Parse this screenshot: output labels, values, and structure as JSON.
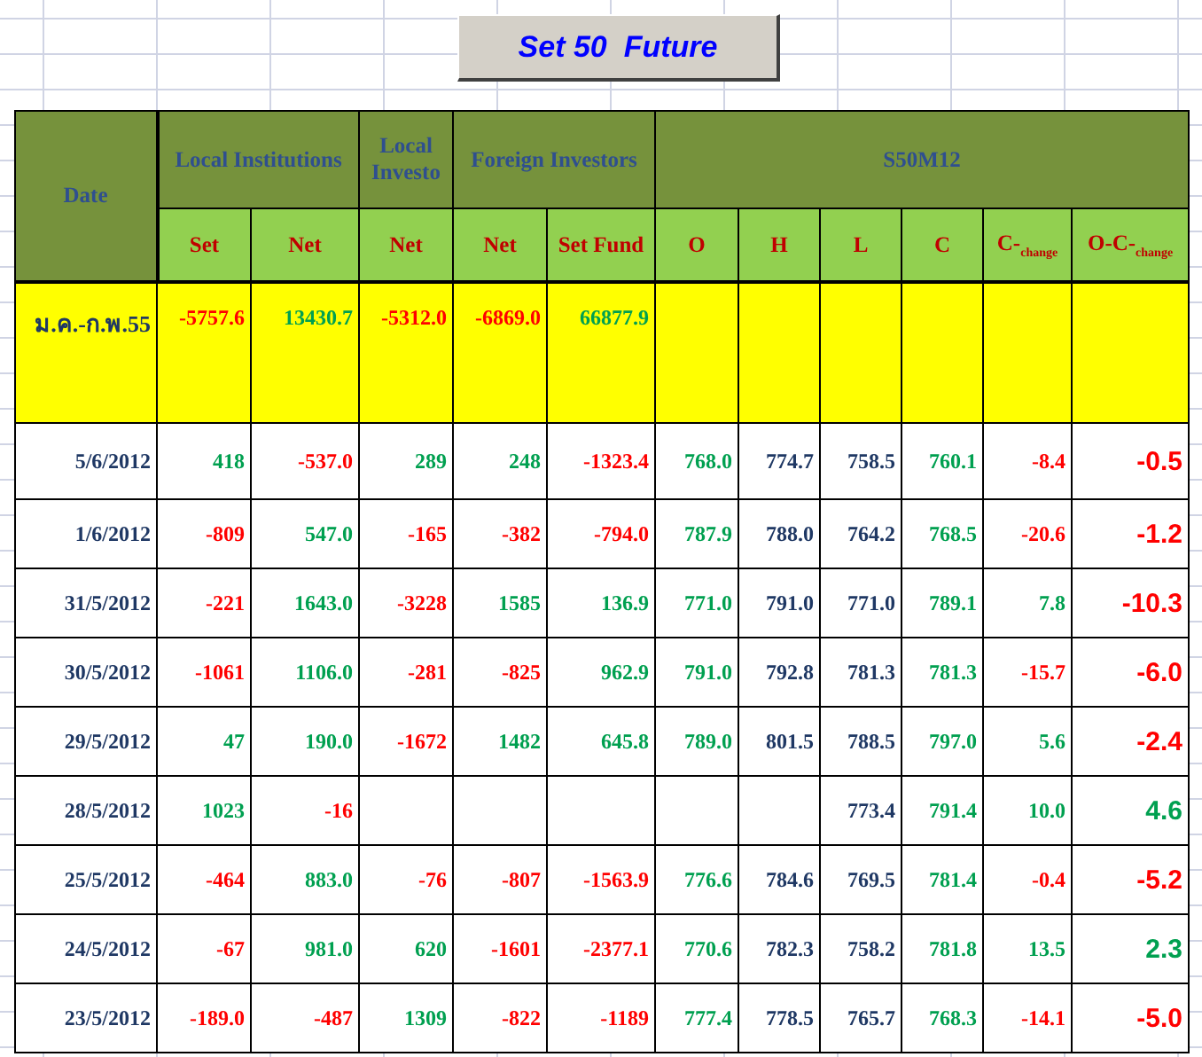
{
  "title": "Set 50  Future",
  "header": {
    "date": "Date",
    "groups": [
      {
        "label": "Local Institutions",
        "columns": [
          "Set",
          "Net"
        ]
      },
      {
        "label": "Local Investo",
        "columns": [
          "Net"
        ]
      },
      {
        "label": "Foreign Investors",
        "columns": [
          "Net",
          "Set Fund"
        ]
      },
      {
        "label": "S50M12",
        "columns": [
          "O",
          "H",
          "L",
          "C",
          "C-$_{change}$",
          "O-C-$_{change}$"
        ]
      }
    ]
  },
  "summary": {
    "date": "ม.ค.-ก.พ.55",
    "cells": [
      {
        "text": "-5757.6",
        "color": "#ff0000"
      },
      {
        "text": "13430.7",
        "color": "#00a050"
      },
      {
        "text": "-5312.0",
        "color": "#ff0000"
      },
      {
        "text": "-6869.0",
        "color": "#ff0000"
      },
      {
        "text": "66877.9",
        "color": "#00a050"
      },
      null,
      null,
      null,
      null,
      null,
      null
    ]
  },
  "rows": [
    {
      "date": "5/6/2012",
      "cells": [
        {
          "text": "418",
          "color": "#00a050"
        },
        {
          "text": "-537.0",
          "color": "#ff0000"
        },
        {
          "text": "289",
          "color": "#00a050"
        },
        {
          "text": "248",
          "color": "#00a050"
        },
        {
          "text": "-1323.4",
          "color": "#ff0000"
        },
        {
          "text": "768.0",
          "color": "#00a050"
        },
        {
          "text": "774.7",
          "color": "#1f3864"
        },
        {
          "text": "758.5",
          "color": "#1f3864"
        },
        {
          "text": "760.1",
          "color": "#00a050"
        },
        {
          "text": "-8.4",
          "color": "#ff0000"
        },
        {
          "text": "-0.5",
          "color": "#ff0000"
        }
      ]
    },
    {
      "date": "1/6/2012",
      "cells": [
        {
          "text": "-809",
          "color": "#ff0000"
        },
        {
          "text": "547.0",
          "color": "#00a050"
        },
        {
          "text": "-165",
          "color": "#ff0000"
        },
        {
          "text": "-382",
          "color": "#ff0000"
        },
        {
          "text": "-794.0",
          "color": "#ff0000"
        },
        {
          "text": "787.9",
          "color": "#00a050"
        },
        {
          "text": "788.0",
          "color": "#1f3864"
        },
        {
          "text": "764.2",
          "color": "#1f3864"
        },
        {
          "text": "768.5",
          "color": "#00a050"
        },
        {
          "text": "-20.6",
          "color": "#ff0000"
        },
        {
          "text": "-1.2",
          "color": "#ff0000"
        }
      ]
    },
    {
      "date": "31/5/2012",
      "cells": [
        {
          "text": "-221",
          "color": "#ff0000"
        },
        {
          "text": "1643.0",
          "color": "#00a050"
        },
        {
          "text": "-3228",
          "color": "#ff0000"
        },
        {
          "text": "1585",
          "color": "#00a050"
        },
        {
          "text": "136.9",
          "color": "#00a050"
        },
        {
          "text": "771.0",
          "color": "#00a050"
        },
        {
          "text": "791.0",
          "color": "#1f3864"
        },
        {
          "text": "771.0",
          "color": "#1f3864"
        },
        {
          "text": "789.1",
          "color": "#00a050"
        },
        {
          "text": "7.8",
          "color": "#00a050"
        },
        {
          "text": "-10.3",
          "color": "#ff0000"
        }
      ]
    },
    {
      "date": "30/5/2012",
      "cells": [
        {
          "text": "-1061",
          "color": "#ff0000"
        },
        {
          "text": "1106.0",
          "color": "#00a050"
        },
        {
          "text": "-281",
          "color": "#ff0000"
        },
        {
          "text": "-825",
          "color": "#ff0000"
        },
        {
          "text": "962.9",
          "color": "#00a050"
        },
        {
          "text": "791.0",
          "color": "#00a050"
        },
        {
          "text": "792.8",
          "color": "#1f3864"
        },
        {
          "text": "781.3",
          "color": "#1f3864"
        },
        {
          "text": "781.3",
          "color": "#00a050"
        },
        {
          "text": "-15.7",
          "color": "#ff0000"
        },
        {
          "text": "-6.0",
          "color": "#ff0000"
        }
      ]
    },
    {
      "date": "29/5/2012",
      "cells": [
        {
          "text": "47",
          "color": "#00a050"
        },
        {
          "text": "190.0",
          "color": "#00a050"
        },
        {
          "text": "-1672",
          "color": "#ff0000"
        },
        {
          "text": "1482",
          "color": "#00a050"
        },
        {
          "text": "645.8",
          "color": "#00a050"
        },
        {
          "text": "789.0",
          "color": "#00a050"
        },
        {
          "text": "801.5",
          "color": "#1f3864"
        },
        {
          "text": "788.5",
          "color": "#1f3864"
        },
        {
          "text": "797.0",
          "color": "#00a050"
        },
        {
          "text": "5.6",
          "color": "#00a050"
        },
        {
          "text": "-2.4",
          "color": "#ff0000"
        }
      ]
    },
    {
      "date": "28/5/2012",
      "cells": [
        {
          "text": "1023",
          "color": "#00a050"
        },
        {
          "text": "-16",
          "color": "#ff0000"
        },
        null,
        null,
        null,
        null,
        null,
        {
          "text": "773.4",
          "color": "#1f3864"
        },
        {
          "text": "791.4",
          "color": "#00a050"
        },
        {
          "text": "10.0",
          "color": "#00a050"
        },
        {
          "text": "4.6",
          "color": "#00a050"
        }
      ]
    },
    {
      "date": "25/5/2012",
      "cells": [
        {
          "text": "-464",
          "color": "#ff0000"
        },
        {
          "text": "883.0",
          "color": "#00a050"
        },
        {
          "text": "-76",
          "color": "#ff0000"
        },
        {
          "text": "-807",
          "color": "#ff0000"
        },
        {
          "text": "-1563.9",
          "color": "#ff0000"
        },
        {
          "text": "776.6",
          "color": "#00a050"
        },
        {
          "text": "784.6",
          "color": "#1f3864"
        },
        {
          "text": "769.5",
          "color": "#1f3864"
        },
        {
          "text": "781.4",
          "color": "#00a050"
        },
        {
          "text": "-0.4",
          "color": "#ff0000"
        },
        {
          "text": "-5.2",
          "color": "#ff0000"
        }
      ]
    },
    {
      "date": "24/5/2012",
      "cells": [
        {
          "text": "-67",
          "color": "#ff0000"
        },
        {
          "text": "981.0",
          "color": "#00a050"
        },
        {
          "text": "620",
          "color": "#00a050"
        },
        {
          "text": "-1601",
          "color": "#ff0000"
        },
        {
          "text": "-2377.1",
          "color": "#ff0000"
        },
        {
          "text": "770.6",
          "color": "#00a050"
        },
        {
          "text": "782.3",
          "color": "#1f3864"
        },
        {
          "text": "758.2",
          "color": "#1f3864"
        },
        {
          "text": "781.8",
          "color": "#00a050"
        },
        {
          "text": "13.5",
          "color": "#00a050"
        },
        {
          "text": "2.3",
          "color": "#00a050"
        }
      ]
    },
    {
      "date": "23/5/2012",
      "cells": [
        {
          "text": "-189.0",
          "color": "#ff0000"
        },
        {
          "text": "-487",
          "color": "#ff0000"
        },
        {
          "text": "1309",
          "color": "#00a050"
        },
        {
          "text": "-822",
          "color": "#ff0000"
        },
        {
          "text": "-1189",
          "color": "#ff0000"
        },
        {
          "text": "777.4",
          "color": "#00a050"
        },
        {
          "text": "778.5",
          "color": "#1f3864"
        },
        {
          "text": "765.7",
          "color": "#1f3864"
        },
        {
          "text": "768.3",
          "color": "#00a050"
        },
        {
          "text": "-14.1",
          "color": "#ff0000"
        },
        {
          "text": "-5.0",
          "color": "#ff0000"
        }
      ]
    }
  ]
}
